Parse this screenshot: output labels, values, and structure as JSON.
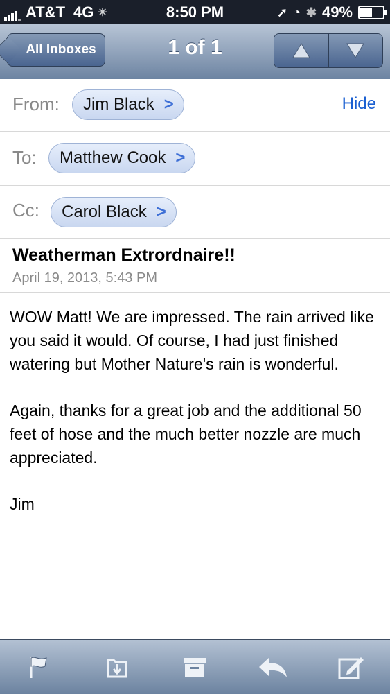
{
  "status": {
    "carrier": "AT&T",
    "network": "4G",
    "time": "8:50 PM",
    "battery": "49%"
  },
  "nav": {
    "back_label": "All Inboxes",
    "title": "1 of 1"
  },
  "header": {
    "from_label": "From:",
    "from_name": "Jim Black",
    "hide_label": "Hide",
    "to_label": "To:",
    "to_name": "Matthew Cook",
    "cc_label": "Cc:",
    "cc_name": "Carol Black"
  },
  "message": {
    "subject": "Weatherman Extrordnaire!!",
    "date": "April 19, 2013, 5:43 PM",
    "paragraphs": [
      "WOW Matt!  We are impressed.  The rain arrived like you said it would.  Of course, I had just finished watering but Mother Nature's rain is wonderful.",
      "Again, thanks for a great job and the additional 50 feet of hose and the much better nozzle are much appreciated.",
      "Jim"
    ]
  },
  "toolbar": {
    "icons": [
      "flag-icon",
      "move-to-folder-icon",
      "archive-icon",
      "reply-icon",
      "compose-icon"
    ]
  },
  "colors": {
    "link": "#1a5fd1",
    "nav_top": "#b8c5d6",
    "nav_bottom": "#6d84a2"
  }
}
